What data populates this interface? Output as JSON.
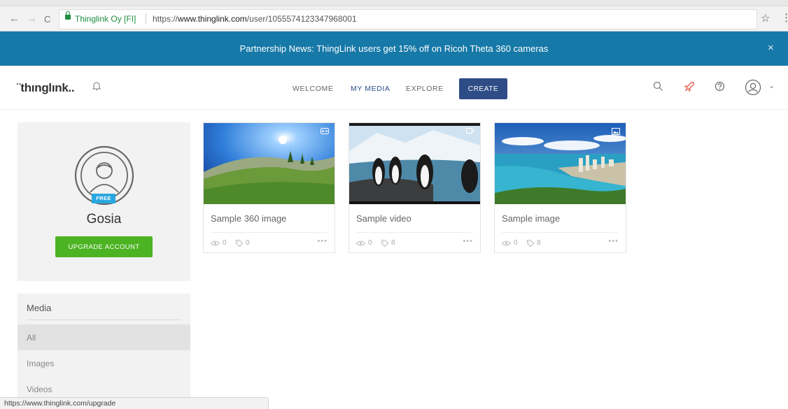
{
  "browser": {
    "site_identity": "Thinglink Oy [FI]",
    "url_scheme": "https://",
    "url_host": "www.thinglink.com",
    "url_path": "/user/1055574123347968001",
    "back_icon": "←",
    "forward_icon": "→",
    "reload_icon": "C",
    "star_icon": "☆",
    "menu_icon": "⋮",
    "status_url": "https://www.thinglink.com/upgrade"
  },
  "banner": {
    "text": "Partnership News: ThingLink users get 15% off on Ricoh Theta 360 cameras",
    "close_icon": "×",
    "color": "#1779a8"
  },
  "header": {
    "logo": "¨thınglınk..",
    "nav": {
      "welcome": "WELCOME",
      "my_media": "MY MEDIA",
      "explore": "EXPLORE"
    },
    "create_label": "CREATE",
    "avatar_caret": "⌄",
    "accent": "#2e4c86"
  },
  "profile": {
    "badge": "FREE",
    "name": "Gosia",
    "upgrade_label": "UPGRADE ACCOUNT",
    "upgrade_color": "#4cb322"
  },
  "media_filter": {
    "title": "Media",
    "items": [
      "All",
      "Images",
      "Videos"
    ],
    "selected": "All"
  },
  "cards": [
    {
      "title": "Sample 360 image",
      "views": "0",
      "tags": "0",
      "more": "•••",
      "type_icon": "vr-headset-icon"
    },
    {
      "title": "Sample video",
      "views": "0",
      "tags": "8",
      "more": "•••",
      "type_icon": "video-camera-icon"
    },
    {
      "title": "Sample image",
      "views": "0",
      "tags": "8",
      "more": "•••",
      "type_icon": "image-icon"
    }
  ]
}
